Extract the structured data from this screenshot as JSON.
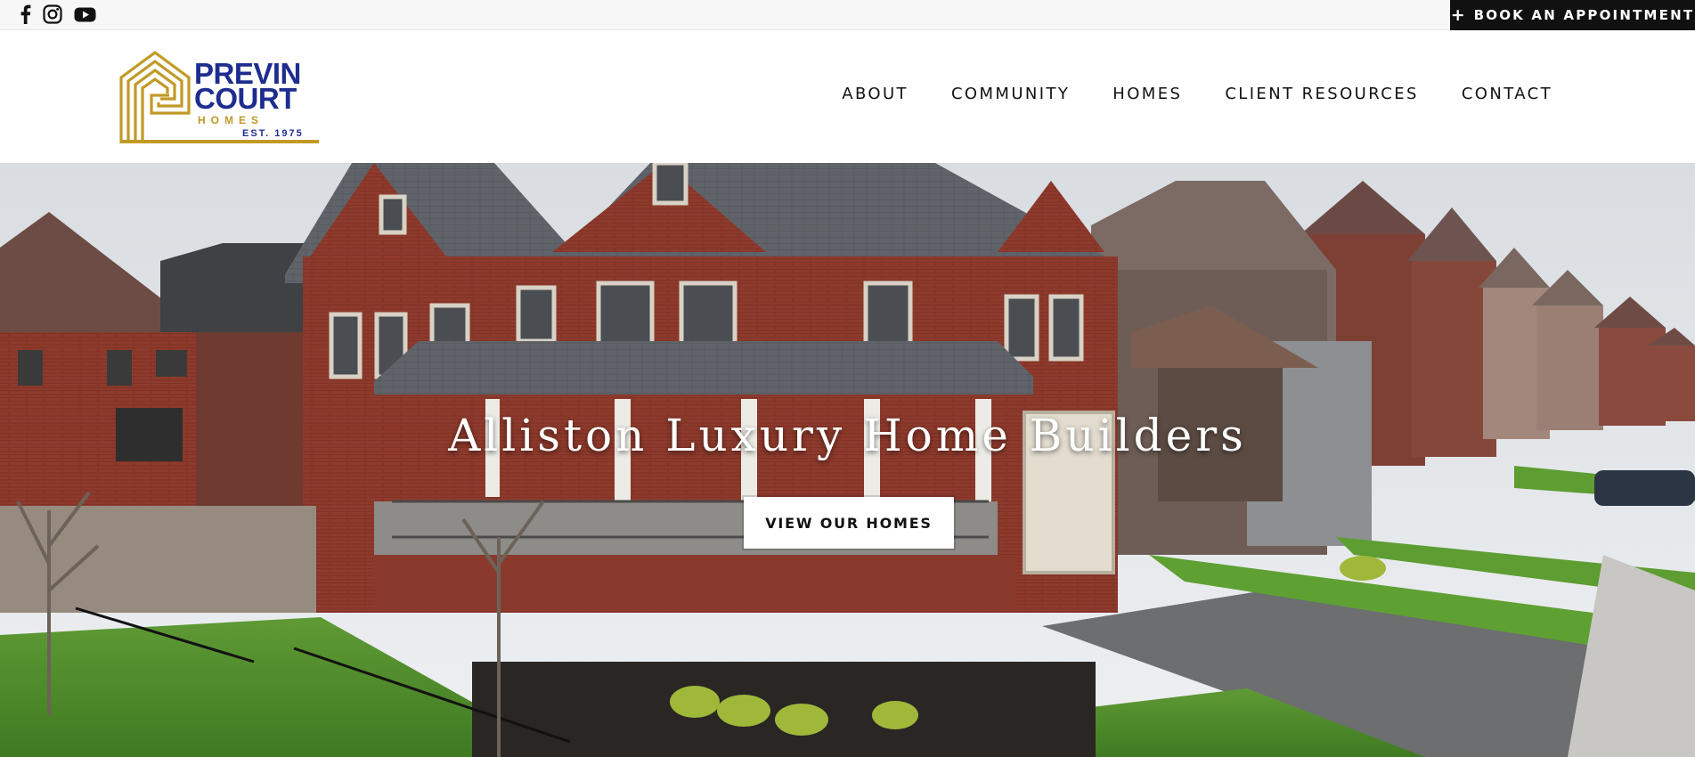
{
  "topbar": {
    "social": [
      {
        "icon": "facebook-icon"
      },
      {
        "icon": "instagram-icon"
      },
      {
        "icon": "youtube-icon"
      }
    ],
    "book_label": "BOOK AN APPOINTMENT"
  },
  "logo": {
    "line1": "PREVIN",
    "line2": "COURT",
    "line3": "HOMES",
    "line4": "EST. 1975"
  },
  "nav": {
    "items": [
      "ABOUT",
      "COMMUNITY",
      "HOMES",
      "CLIENT RESOURCES",
      "CONTACT"
    ]
  },
  "hero": {
    "title": "Alliston Luxury Home Builders",
    "cta_label": "VIEW OUR HOMES"
  },
  "colors": {
    "brand_blue": "#1e2d8f",
    "brand_gold": "#c19a26",
    "brick": "#8e3a2c",
    "roof": "#5f6266"
  }
}
